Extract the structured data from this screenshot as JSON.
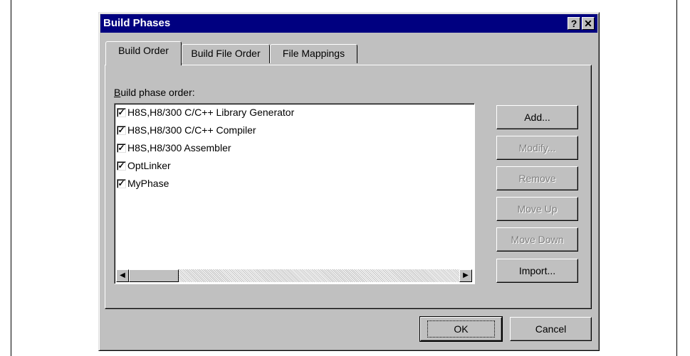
{
  "dialog": {
    "title": "Build Phases",
    "help_glyph": "?",
    "close_glyph": "✕"
  },
  "tabs": [
    {
      "label": "Build Order",
      "active": true
    },
    {
      "label": "Build File Order",
      "active": false
    },
    {
      "label": "File Mappings",
      "active": false
    }
  ],
  "build_order": {
    "list_label": "Build phase order:",
    "items": [
      {
        "label": "H8S,H8/300 C/C++ Library Generator",
        "checked": true
      },
      {
        "label": "H8S,H8/300 C/C++ Compiler",
        "checked": true
      },
      {
        "label": "H8S,H8/300 Assembler",
        "checked": true
      },
      {
        "label": "OptLinker",
        "checked": true
      },
      {
        "label": "MyPhase",
        "checked": true
      }
    ],
    "check_glyph": "✓",
    "scroll_left_glyph": "◀",
    "scroll_right_glyph": "▶"
  },
  "side_buttons": {
    "add": "Add...",
    "modify": "Modify...",
    "remove": "Remove",
    "move_up": "Move Up",
    "move_down": "Move Down",
    "import": "Import..."
  },
  "footer": {
    "ok": "OK",
    "cancel": "Cancel"
  },
  "colors": {
    "titlebar": "#000080",
    "face": "#c0c0c0"
  }
}
